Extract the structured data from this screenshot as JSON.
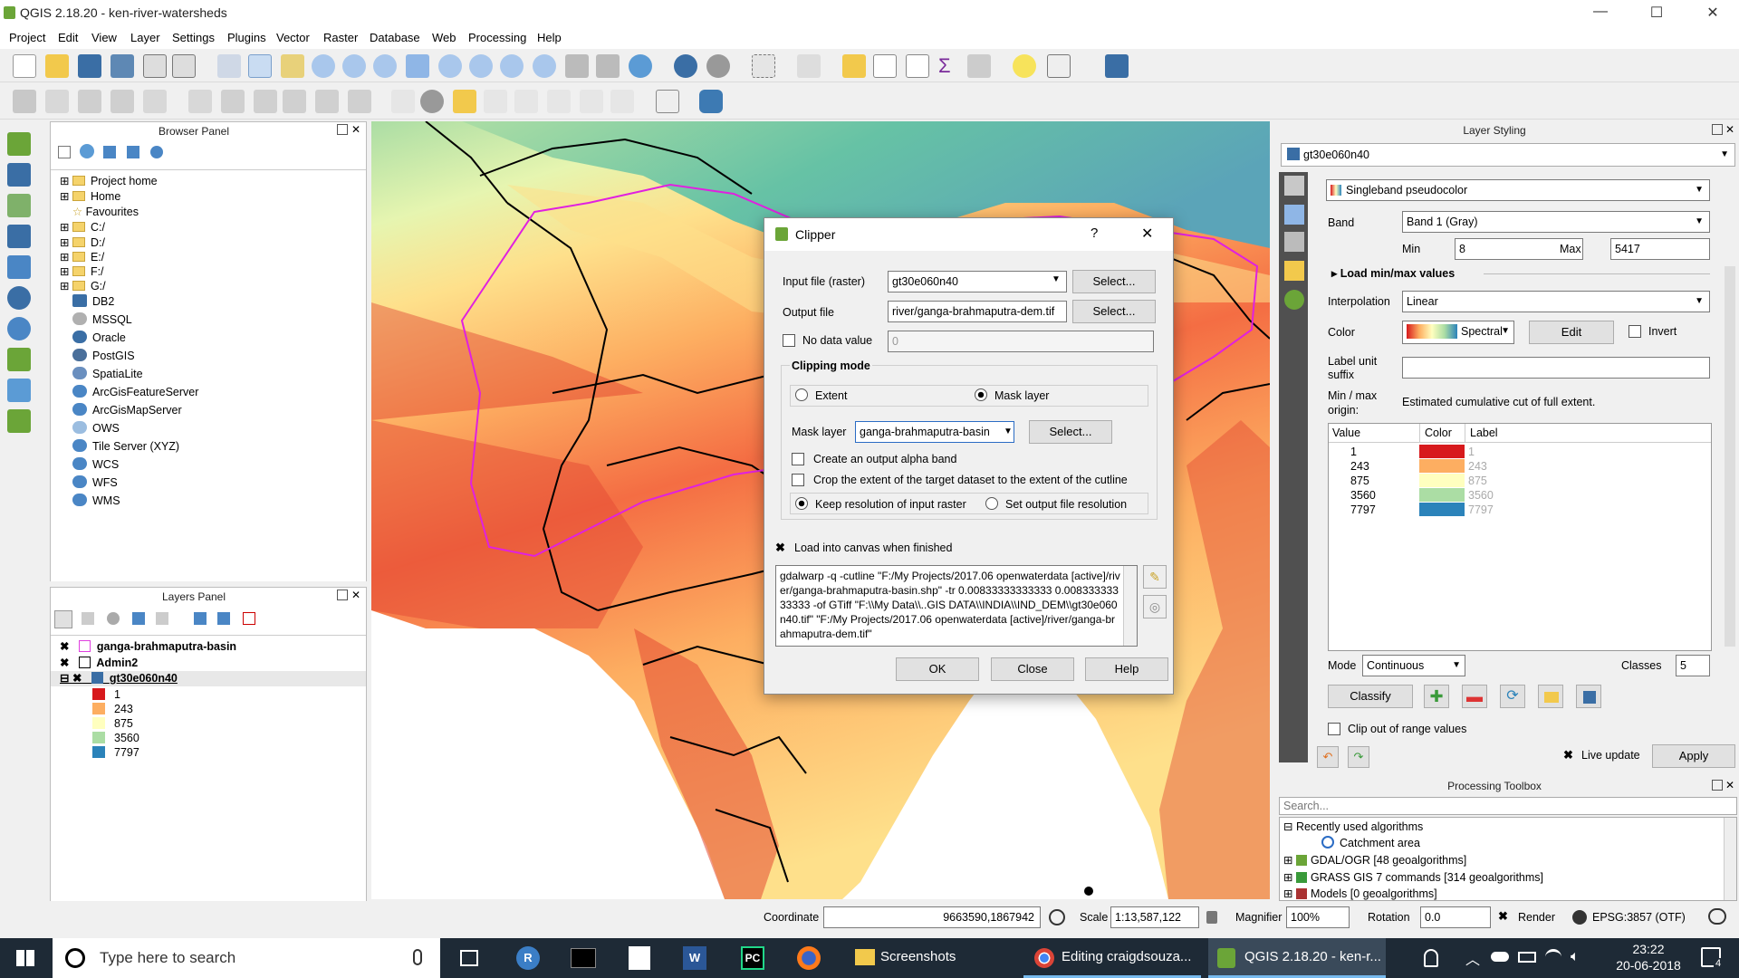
{
  "window": {
    "title": "QGIS 2.18.20 - ken-river-watersheds",
    "minimize": "—",
    "maximize": "☐",
    "close": "✕"
  },
  "menu": [
    "Project",
    "Edit",
    "View",
    "Layer",
    "Settings",
    "Plugins",
    "Vector",
    "Raster",
    "Database",
    "Web",
    "Processing",
    "Help"
  ],
  "browser": {
    "title": "Browser Panel",
    "items": [
      "Project home",
      "Home",
      "Favourites",
      "C:/",
      "D:/",
      "E:/",
      "F:/",
      "G:/",
      "DB2",
      "MSSQL",
      "Oracle",
      "PostGIS",
      "SpatiaLite",
      "ArcGisFeatureServer",
      "ArcGisMapServer",
      "OWS",
      "Tile Server (XYZ)",
      "WCS",
      "WFS",
      "WMS"
    ]
  },
  "layers": {
    "title": "Layers Panel",
    "items": [
      "ganga-brahmaputra-basin",
      "Admin2",
      "gt30e060n40"
    ],
    "legend": [
      {
        "label": "1",
        "color": "#d7191c"
      },
      {
        "label": "243",
        "color": "#fdae61"
      },
      {
        "label": "875",
        "color": "#ffffbf"
      },
      {
        "label": "3560",
        "color": "#abdda4"
      },
      {
        "label": "7797",
        "color": "#2b83ba"
      }
    ]
  },
  "dialog": {
    "title": "Clipper",
    "help": "?",
    "close": "✕",
    "input_label": "Input file (raster)",
    "input_value": "gt30e060n40",
    "select": "Select...",
    "output_label": "Output file",
    "output_value": "river/ganga-brahmaputra-dem.tif",
    "nodata_label": "No data value",
    "nodata_value": "0",
    "clip_mode": "Clipping mode",
    "extent": "Extent",
    "mask_layer_opt": "Mask layer",
    "mask_label": "Mask layer",
    "mask_value": "ganga-brahmaputra-basin",
    "alpha": "Create an output alpha band",
    "crop": "Crop the extent of the target dataset to the extent of the cutline",
    "keep_res": "Keep resolution of input raster",
    "set_res": "Set output file resolution",
    "load": "Load into canvas when finished",
    "command": "gdalwarp -q -cutline \"F:/My Projects/2017.06 openwaterdata [active]/river/ganga-brahmaputra-basin.shp\" -tr 0.00833333333333 0.00833333333333 -of GTiff \"F:\\\\My Data\\\\..GIS DATA\\\\INDIA\\\\IND_DEM\\\\gt30e060n40.tif\" \"F:/My Projects/2017.06 openwaterdata [active]/river/ganga-brahmaputra-dem.tif\"",
    "ok": "OK",
    "close_btn": "Close",
    "help_btn": "Help"
  },
  "styling": {
    "title": "Layer Styling",
    "layer": "gt30e060n40",
    "renderer": "Singleband pseudocolor",
    "band_label": "Band",
    "band": "Band 1 (Gray)",
    "min_label": "Min",
    "min": "8",
    "max_label": "Max",
    "max": "5417",
    "load_minmax": "Load min/max values",
    "interp_label": "Interpolation",
    "interp": "Linear",
    "color_label": "Color",
    "color_ramp": "Spectral",
    "edit": "Edit",
    "invert": "Invert",
    "label_unit": "Label unit",
    "suffix": "suffix",
    "minmax_origin1": "Min / max",
    "minmax_origin2": "origin:",
    "origin_value": "Estimated cumulative cut of full extent.",
    "col_value": "Value",
    "col_color": "Color",
    "col_label": "Label",
    "rows": [
      {
        "v": "1",
        "c": "#d7191c"
      },
      {
        "v": "243",
        "c": "#fdae61"
      },
      {
        "v": "875",
        "c": "#ffffbf"
      },
      {
        "v": "3560",
        "c": "#abdda4"
      },
      {
        "v": "7797",
        "c": "#2b83ba"
      }
    ],
    "mode_label": "Mode",
    "mode": "Continuous",
    "classes_label": "Classes",
    "classes": "5",
    "classify": "Classify",
    "clip_range": "Clip out of range values",
    "live_update": "Live update",
    "apply": "Apply"
  },
  "toolbox": {
    "title": "Processing Toolbox",
    "search_placeholder": "Search...",
    "items": [
      "Recently used algorithms",
      "Catchment area",
      "GDAL/OGR [48 geoalgorithms]",
      "GRASS GIS 7 commands [314 geoalgorithms]",
      "Models [0 geoalgorithms]"
    ]
  },
  "status": {
    "coord_label": "Coordinate",
    "coord": "9663590,1867942",
    "scale_label": "Scale",
    "scale": "1:13,587,122",
    "magnifier_label": "Magnifier",
    "magnifier": "100%",
    "rotation_label": "Rotation",
    "rotation": "0.0",
    "render": "Render",
    "crs": "EPSG:3857 (OTF)"
  },
  "taskbar": {
    "search": "Type here to search",
    "apps": [
      "Screenshots",
      "Editing craigdsouza...",
      "QGIS 2.18.20 - ken-r..."
    ],
    "time": "23:22",
    "date": "20-06-2018",
    "notif": "4"
  }
}
